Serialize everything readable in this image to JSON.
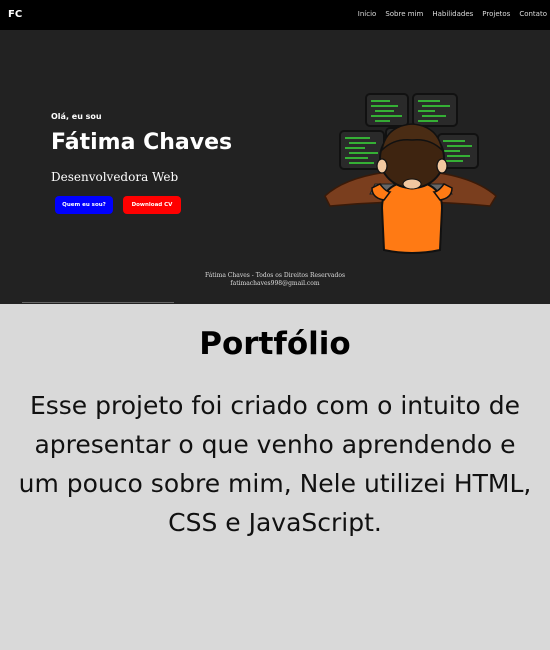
{
  "navbar": {
    "logo": "FC",
    "links": [
      "Início",
      "Sobre mim",
      "Habilidades",
      "Projetos",
      "Contato"
    ]
  },
  "hero": {
    "greeting": "Olá, eu sou",
    "name": "Fátima Chaves",
    "role": "Desenvolvedora Web",
    "button_about": "Quem eu sou?",
    "button_cv": "Download CV",
    "footer_line1": "Fátima Chaves - Todos os Direitos Reservados",
    "footer_line2": "fatimachaves998@gmail.com",
    "colors": {
      "background": "#222222",
      "button_about": "#0000ff",
      "button_cv": "#ff0000"
    }
  },
  "portfolio": {
    "title": "Portfólio",
    "text_lines": [
      "Esse projeto foi criado com o intuito de",
      "apresentar o que venho aprendendo e",
      "um pouco sobre mim, Nele utilizei HTML,",
      "CSS e JavaScript."
    ]
  }
}
